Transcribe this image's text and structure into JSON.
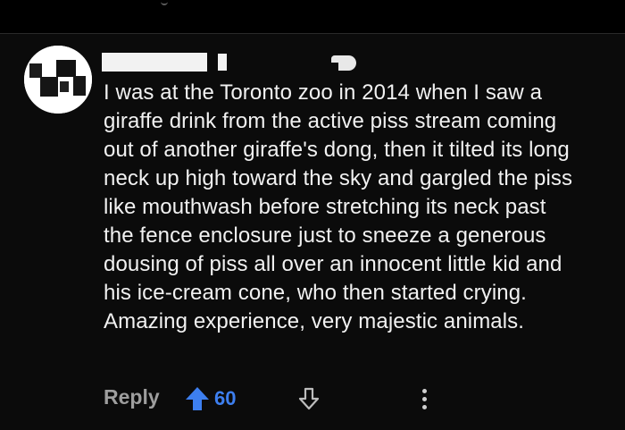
{
  "comment": {
    "text_lines": [
      "I was at the Toronto zoo in 2014 when I saw a",
      "giraffe drink from the active piss stream coming",
      "out of another giraffe's dong, then it tilted its long",
      "neck up high toward the sky and gargled the piss",
      "like mouthwash before stretching its neck past",
      "the fence enclosure just to sneeze a generous",
      "dousing of piss all over an innocent little kid and",
      "his ice-cream cone, who then started crying.",
      "Amazing experience, very majestic animals."
    ],
    "reply_label": "Reply",
    "upvote_count": "60",
    "icons": {
      "upvote": "arrow-up-icon",
      "downvote": "arrow-down-icon",
      "more": "more-vertical-icon"
    }
  },
  "colors": {
    "background": "#0b0b0b",
    "text": "#f1f1f1",
    "muted": "#9e9e9e",
    "accent_upvote": "#3d7ff0"
  }
}
